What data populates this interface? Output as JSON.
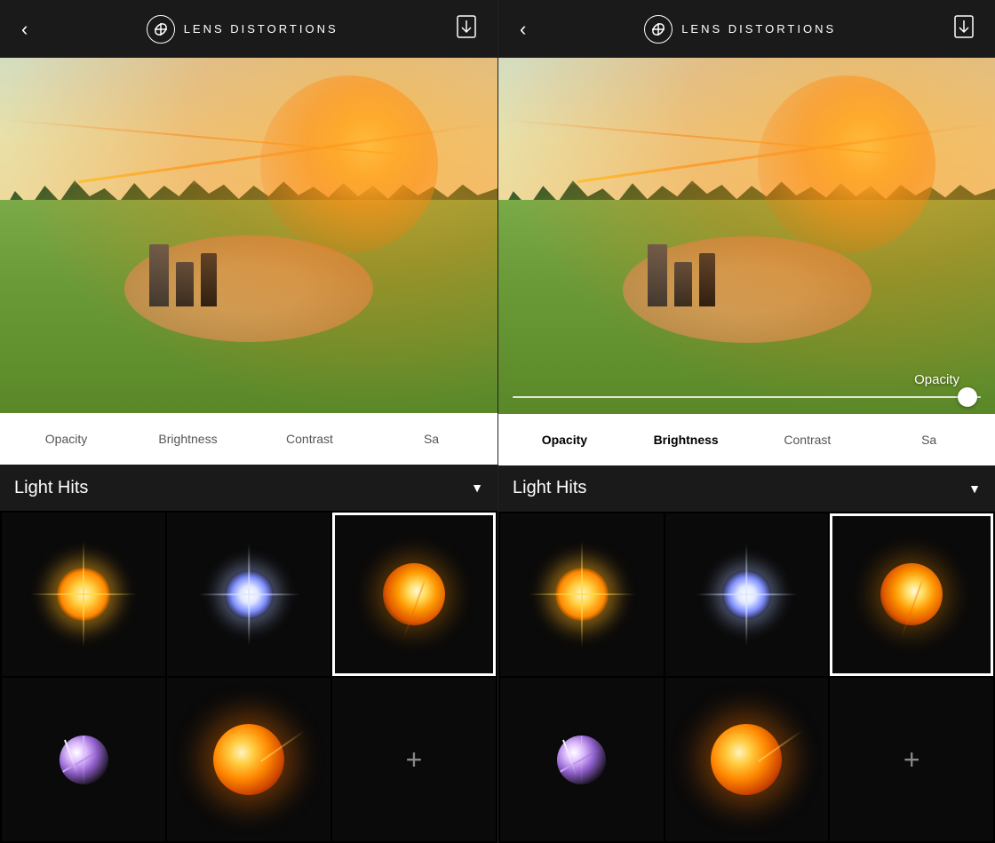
{
  "panels": [
    {
      "id": "left",
      "header": {
        "back_label": "‹",
        "title": "LENS DISTORTIONS",
        "download_icon": "download-icon"
      },
      "controls": {
        "items": [
          {
            "label": "Opacity",
            "active": false
          },
          {
            "label": "Brightness",
            "active": false
          },
          {
            "label": "Contrast",
            "active": false
          },
          {
            "label": "Sa",
            "active": false
          }
        ]
      },
      "light_hits": {
        "title": "Light Hits",
        "dropdown_label": "▼"
      },
      "has_opacity_slider": false
    },
    {
      "id": "right",
      "header": {
        "back_label": "‹",
        "title": "LENS DISTORTIONS",
        "download_icon": "download-icon"
      },
      "controls": {
        "items": [
          {
            "label": "Opacity",
            "active": true
          },
          {
            "label": "Brightness",
            "active": true
          },
          {
            "label": "Contrast",
            "active": false
          },
          {
            "label": "Sa",
            "active": false
          }
        ]
      },
      "light_hits": {
        "title": "Light Hits",
        "dropdown_label": "▼"
      },
      "has_opacity_slider": true,
      "slider": {
        "label": "Opacity",
        "value": 95
      }
    }
  ],
  "thumbnails": [
    {
      "id": 1,
      "type": "star-yellow",
      "selected": false
    },
    {
      "id": 2,
      "type": "star-white",
      "selected": false
    },
    {
      "id": 3,
      "type": "lens-streak",
      "selected": true
    },
    {
      "id": 4,
      "type": "flare-purple",
      "selected": false
    },
    {
      "id": 5,
      "type": "glow-orange",
      "selected": false
    },
    {
      "id": 6,
      "type": "add",
      "selected": false
    }
  ]
}
